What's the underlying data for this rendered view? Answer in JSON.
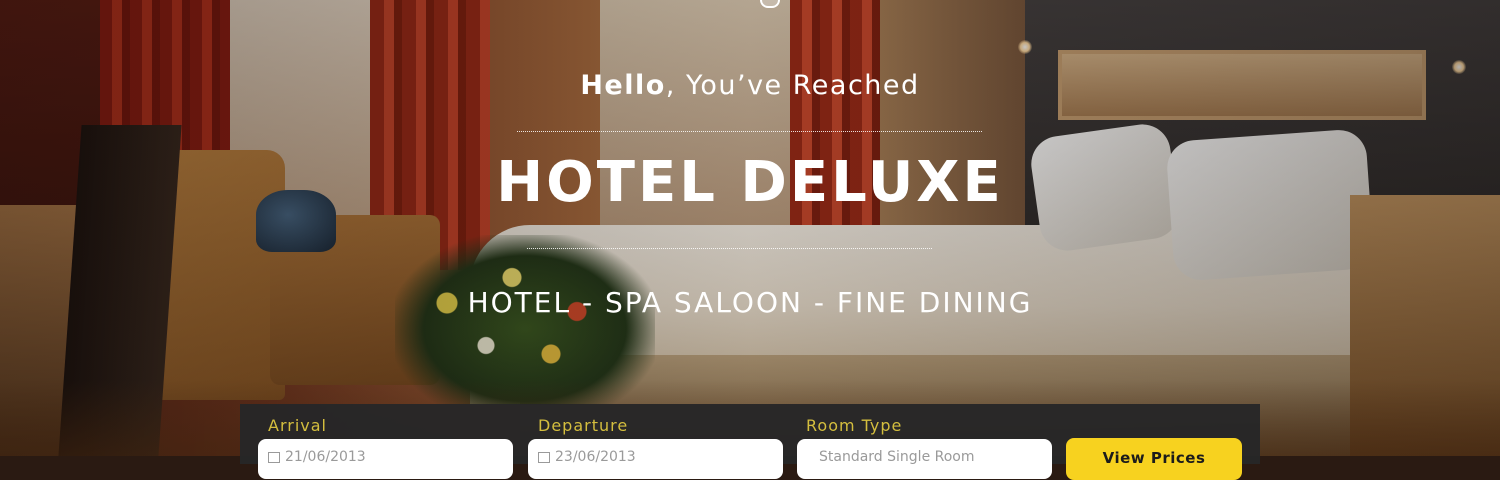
{
  "hero": {
    "greeting_strong": "Hello",
    "greeting_rest": ", You’ve Reached",
    "title": "HOTEL DELUXE",
    "tagline": "HOTEL - SPA SALOON - FINE DINING"
  },
  "booking": {
    "arrival": {
      "label": "Arrival",
      "value": "21/06/2013"
    },
    "departure": {
      "label": "Departure",
      "value": "23/06/2013"
    },
    "room_type": {
      "label": "Room Type",
      "value": "Standard Single Room"
    },
    "button_label": "View Prices"
  },
  "colors": {
    "accent_yellow": "#f7d21f",
    "label_gold": "#d4be3e",
    "booking_bar": "#262628"
  },
  "icons": [
    "calendar-icon",
    "top-badge-icon"
  ]
}
